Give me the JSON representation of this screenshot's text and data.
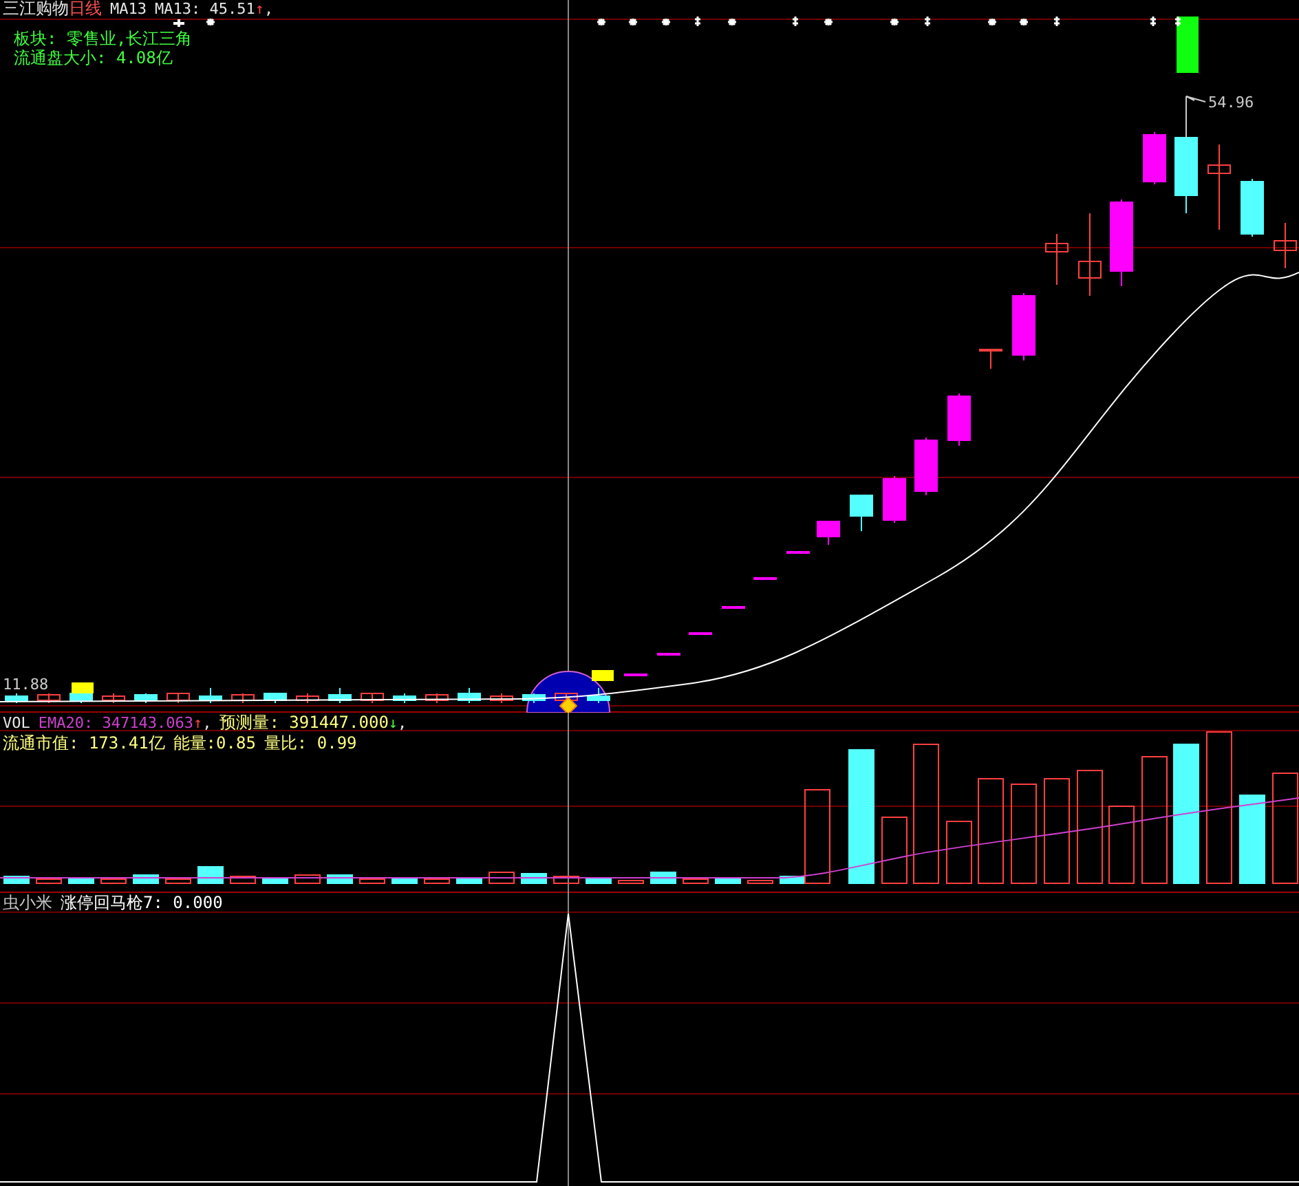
{
  "header": {
    "stock_name": "三江购物",
    "period": "日线",
    "indicator": "MA13",
    "ma_reading": "MA13: 45.51",
    "ma_arrow": "↑",
    "separator": ","
  },
  "info": [
    "板块: 零售业,长江三角",
    "流通盘大小: 4.08亿"
  ],
  "price_labels": {
    "high": "54.96",
    "low": "11.88"
  },
  "volume": {
    "name": "VOL",
    "ema_reading": "EMA20: 347143.063",
    "ema_arrow": "↑",
    "separator": ",",
    "forecast_reading": "预测量: 391447.000",
    "forecast_arrow": "↓",
    "forecast_separator": ",",
    "stats": [
      "流通市值: 173.41亿",
      "能量:0.85",
      "量比: 0.99"
    ]
  },
  "indicator": {
    "author": "虫小米",
    "reading": "涨停回马枪7: 0.000"
  }
}
